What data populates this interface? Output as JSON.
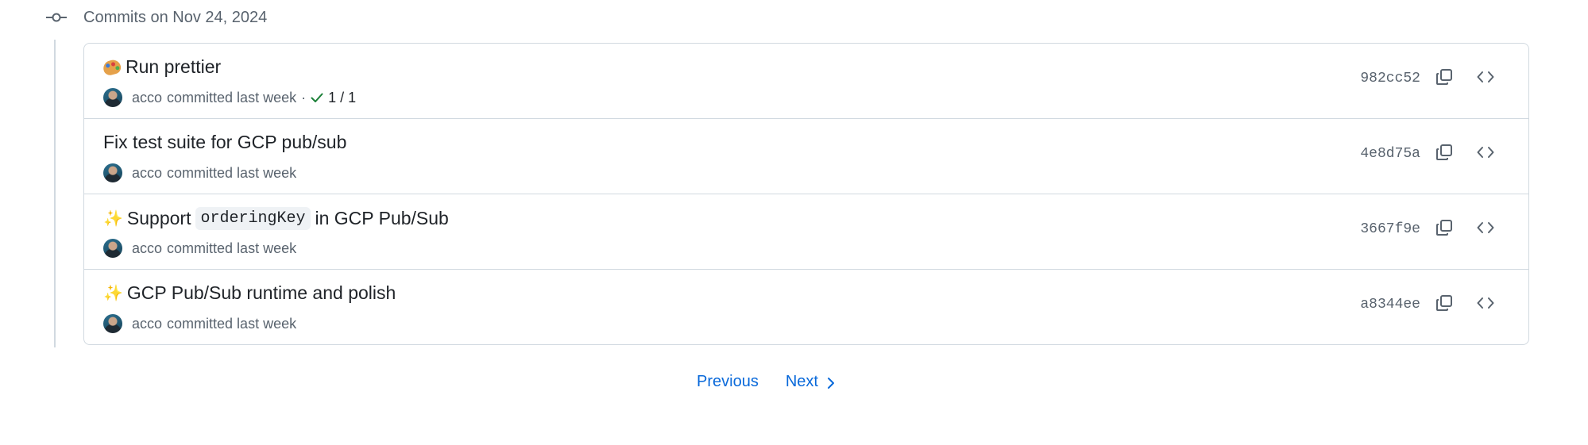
{
  "group": {
    "title": "Commits on Nov 24, 2024"
  },
  "commits": [
    {
      "emoji": "palette",
      "title": "Run prettier",
      "title_pre": "",
      "code": "",
      "title_post": "",
      "author": "acco",
      "action": "committed last week",
      "separator": "·",
      "checks": "1 / 1",
      "sha": "982cc52"
    },
    {
      "emoji": "",
      "title": "Fix test suite for GCP pub/sub",
      "title_pre": "",
      "code": "",
      "title_post": "",
      "author": "acco",
      "action": "committed last week",
      "sha": "4e8d75a"
    },
    {
      "emoji": "sparkles",
      "title": "",
      "title_pre": "Support",
      "code": "orderingKey",
      "title_post": "in GCP Pub/Sub",
      "author": "acco",
      "action": "committed last week",
      "sha": "3667f9e"
    },
    {
      "emoji": "sparkles",
      "title": "GCP Pub/Sub runtime and polish",
      "title_pre": "",
      "code": "",
      "title_post": "",
      "author": "acco",
      "action": "committed last week",
      "sha": "a8344ee"
    }
  ],
  "pagination": {
    "previous_label": "Previous",
    "next_label": "Next"
  },
  "colors": {
    "link": "#0969da",
    "muted": "#59636e",
    "border": "#d1d9e0",
    "success": "#1a7f37"
  },
  "icons": {
    "group": "git-commit-icon",
    "copy": "copy-icon",
    "browse": "code-icon",
    "check": "check-icon",
    "next": "chevron-right-icon"
  }
}
